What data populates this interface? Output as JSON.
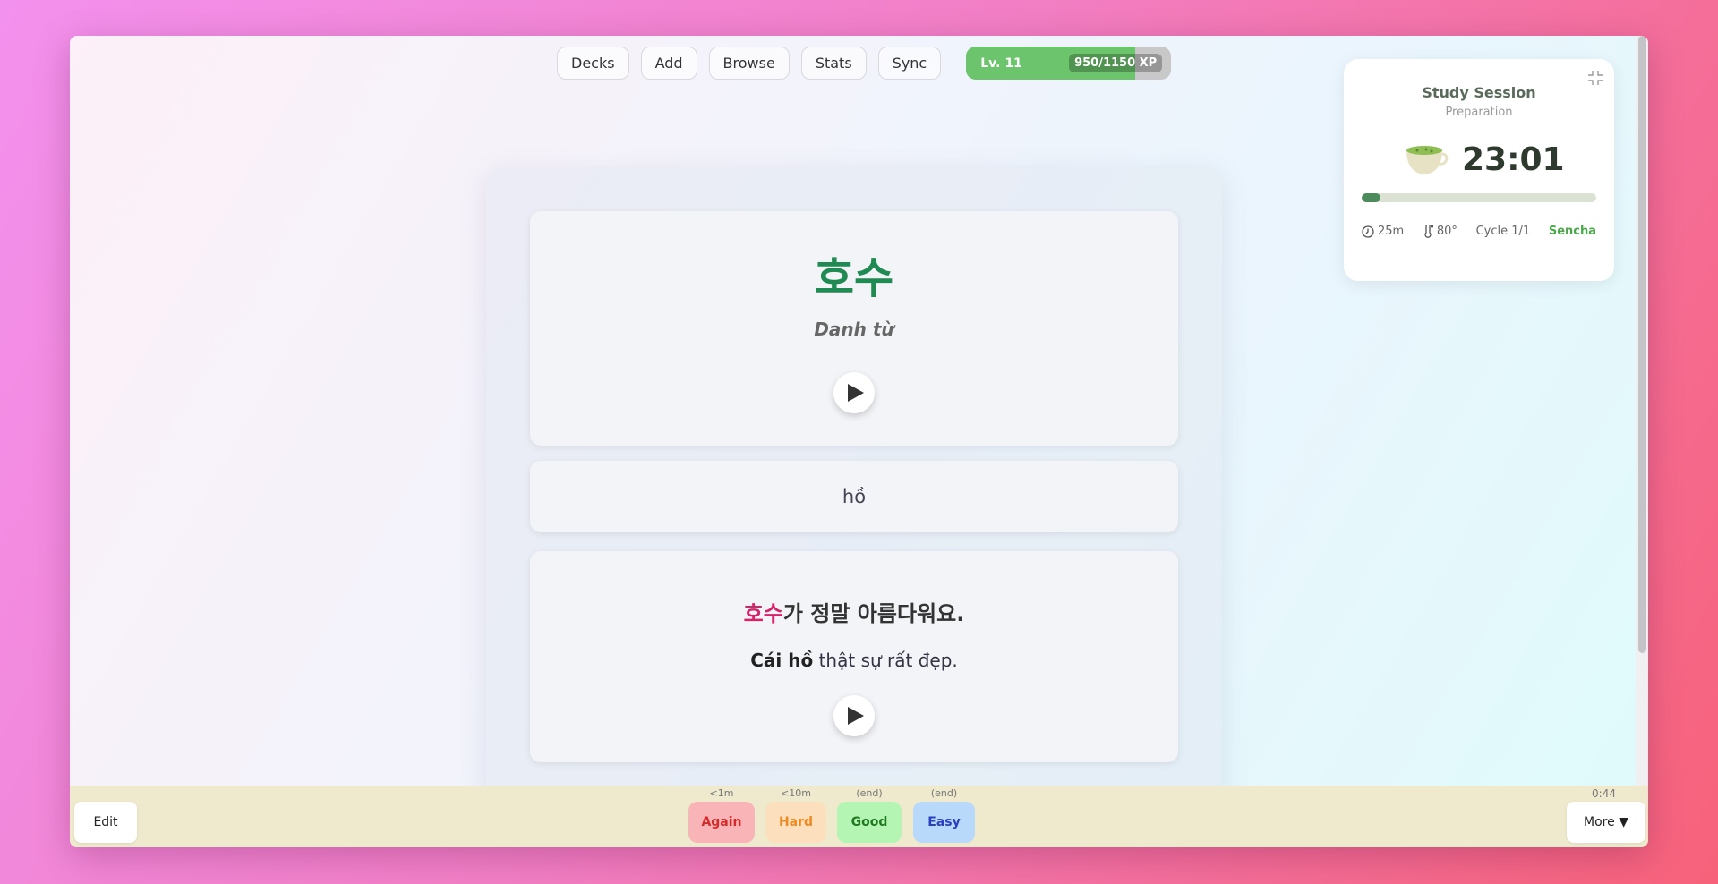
{
  "nav": {
    "items": [
      "Decks",
      "Add",
      "Browse",
      "Stats",
      "Sync"
    ],
    "level_label": "Lv. 11",
    "xp_text": "950/1150 XP",
    "xp_progress": 0.826
  },
  "card": {
    "word": "호수",
    "part_of_speech": "Danh từ",
    "meaning": "hồ",
    "example_highlight": "호수",
    "example_rest": "가 정말 아름다워요.",
    "translation_bold": "Cái hồ",
    "translation_rest": " thật sự rất đẹp."
  },
  "session": {
    "title": "Study Session",
    "subtitle": "Preparation",
    "time": "23:01",
    "progress": 0.08,
    "duration": "25m",
    "temperature": "80°",
    "cycle": "Cycle 1/1",
    "tea": "Sencha"
  },
  "bottom": {
    "edit_label": "Edit",
    "more_label": "More ▼",
    "elapsed": "0:44",
    "answers": [
      {
        "label": "Again",
        "hint": "<1m"
      },
      {
        "label": "Hard",
        "hint": "<10m"
      },
      {
        "label": "Good",
        "hint": "(end)"
      },
      {
        "label": "Easy",
        "hint": "(end)"
      }
    ]
  }
}
